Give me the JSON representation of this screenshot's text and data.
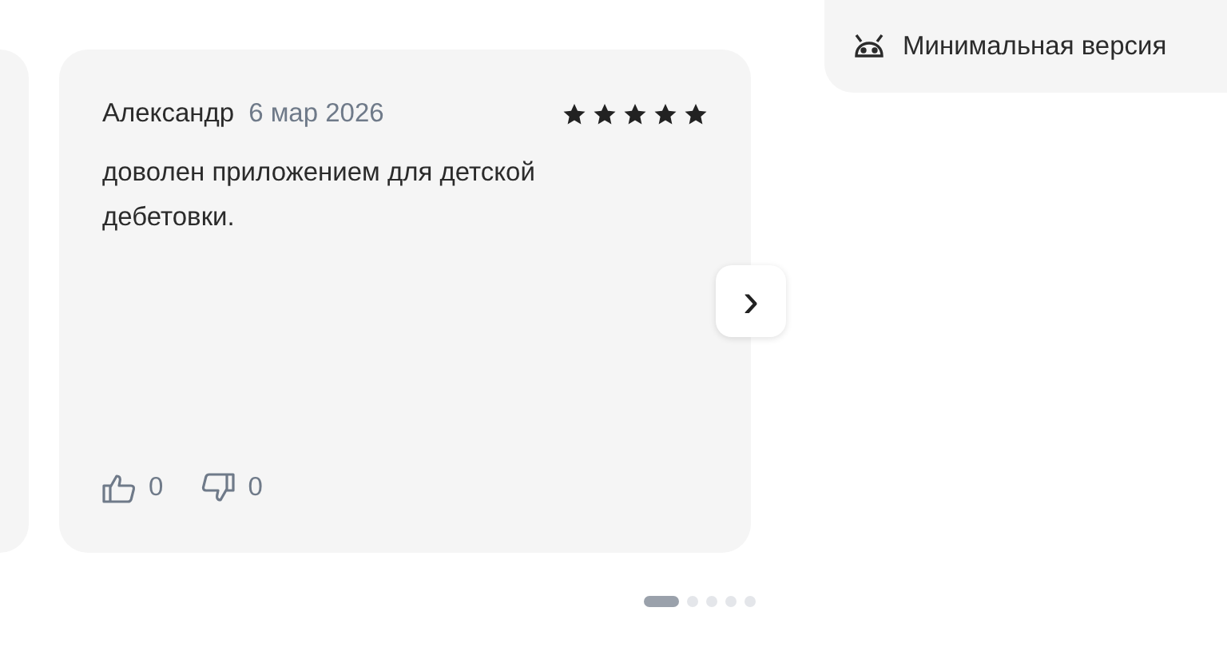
{
  "review": {
    "author": "Александр",
    "date": "6 мар 2026",
    "stars": 5,
    "text": "доволен приложением для детской дебетовки.",
    "likes": "0",
    "dislikes": "0"
  },
  "next_button": {
    "label": "›"
  },
  "info_panel": {
    "text": "Минимальная версия"
  },
  "pager": [
    {
      "selected": true
    },
    {
      "selected": false
    },
    {
      "selected": false
    },
    {
      "selected": false
    },
    {
      "selected": false
    }
  ]
}
